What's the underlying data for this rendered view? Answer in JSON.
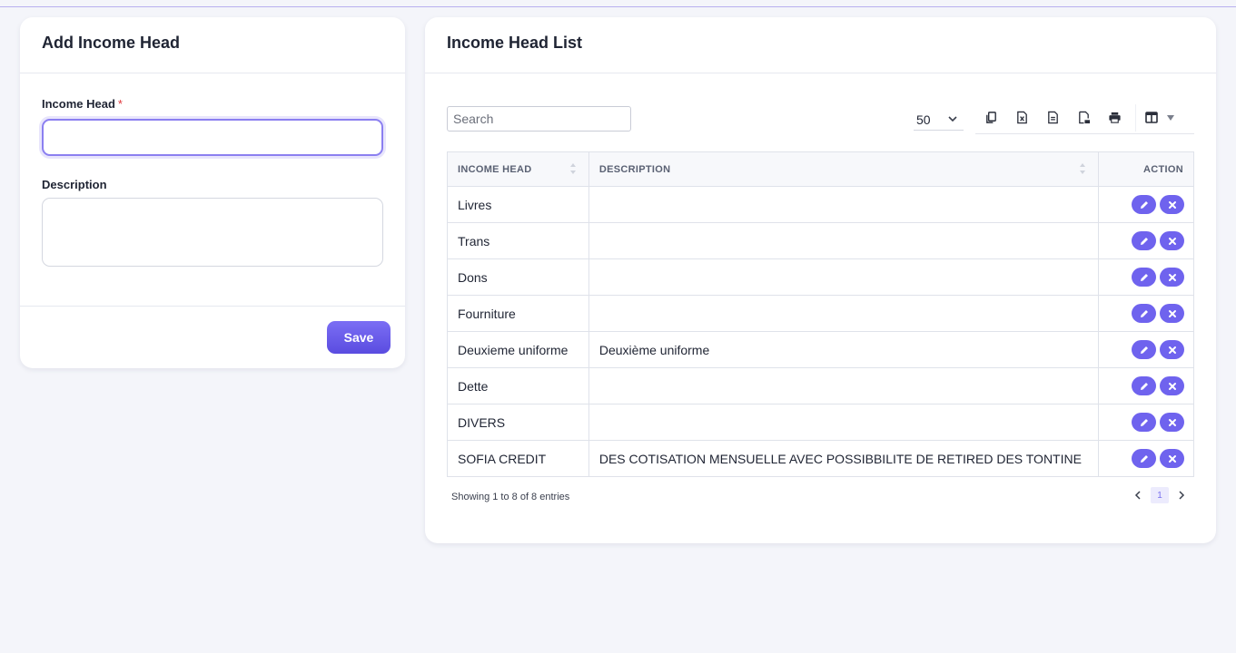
{
  "add_form": {
    "title": "Add Income Head",
    "income_head_label": "Income Head",
    "required_mark": "*",
    "income_head_value": "",
    "description_label": "Description",
    "description_value": "",
    "save_label": "Save"
  },
  "list": {
    "title": "Income Head List",
    "search_placeholder": "Search",
    "page_size": "50",
    "toolbar_icons": [
      "copy-icon",
      "excel-icon",
      "csv-icon",
      "pdf-icon",
      "print-icon",
      "column-visibility-icon"
    ],
    "columns": [
      "INCOME HEAD",
      "DESCRIPTION",
      "ACTION"
    ],
    "rows": [
      {
        "income_head": "Livres",
        "description": ""
      },
      {
        "income_head": "Trans",
        "description": ""
      },
      {
        "income_head": "Dons",
        "description": ""
      },
      {
        "income_head": "Fourniture",
        "description": ""
      },
      {
        "income_head": "Deuxieme uniforme",
        "description": "Deuxième uniforme"
      },
      {
        "income_head": "Dette",
        "description": ""
      },
      {
        "income_head": "DIVERS",
        "description": ""
      },
      {
        "income_head": "SOFIA CREDIT",
        "description": "DES COTISATION MENSUELLE AVEC POSSIBBILITE DE RETIRED DES TONTINE"
      }
    ],
    "info": "Showing 1 to 8 of 8 entries",
    "current_page": "1",
    "colors": {
      "accent": "#6f63ee",
      "border": "#dfe2ea"
    }
  }
}
